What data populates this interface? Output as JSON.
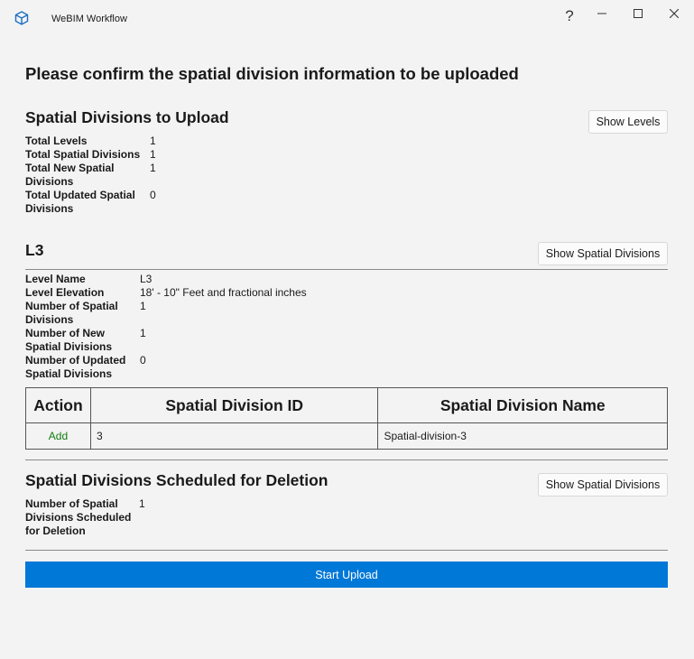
{
  "window": {
    "title": "WeBIM Workflow",
    "help": "?",
    "minimize": "—",
    "maximize": "☐",
    "close": "✕"
  },
  "heading": "Please confirm the spatial division information to be uploaded",
  "summary": {
    "title": "Spatial Divisions to Upload",
    "show_button": "Show Levels",
    "rows": [
      {
        "label_lines": [
          "Total Levels"
        ],
        "value": "1"
      },
      {
        "label_lines": [
          "Total Spatial Divisions"
        ],
        "value": "1"
      },
      {
        "label_lines": [
          "Total New Spatial",
          "Divisions"
        ],
        "value": "1"
      },
      {
        "label_lines": [
          "Total Updated Spatial",
          "Divisions"
        ],
        "value": "0"
      }
    ]
  },
  "level": {
    "title": "L3",
    "show_button": "Show Spatial Divisions",
    "rows": [
      {
        "label_lines": [
          "Level Name"
        ],
        "value": "L3"
      },
      {
        "label_lines": [
          "Level Elevation"
        ],
        "value": "18' - 10\" Feet and fractional inches"
      },
      {
        "label_lines": [
          "Number of Spatial",
          "Divisions"
        ],
        "value": "1"
      },
      {
        "label_lines": [
          "Number of New",
          "Spatial Divisions"
        ],
        "value": "1"
      },
      {
        "label_lines": [
          "Number of Updated",
          "Spatial Divisions"
        ],
        "value": "0"
      }
    ],
    "table": {
      "headers": [
        "Action",
        "Spatial Division ID",
        "Spatial Division Name"
      ],
      "rows": [
        {
          "action": "Add",
          "id": "3",
          "name": "Spatial-division-3"
        }
      ]
    }
  },
  "deletion": {
    "title": "Spatial Divisions Scheduled for Deletion",
    "show_button": "Show Spatial Divisions",
    "rows": [
      {
        "label_lines": [
          "Number of Spatial",
          "Divisions Scheduled",
          "for Deletion"
        ],
        "value": "1"
      }
    ]
  },
  "start_button": "Start Upload",
  "colors": {
    "accent": "#0078d7",
    "add": "#107c10"
  }
}
